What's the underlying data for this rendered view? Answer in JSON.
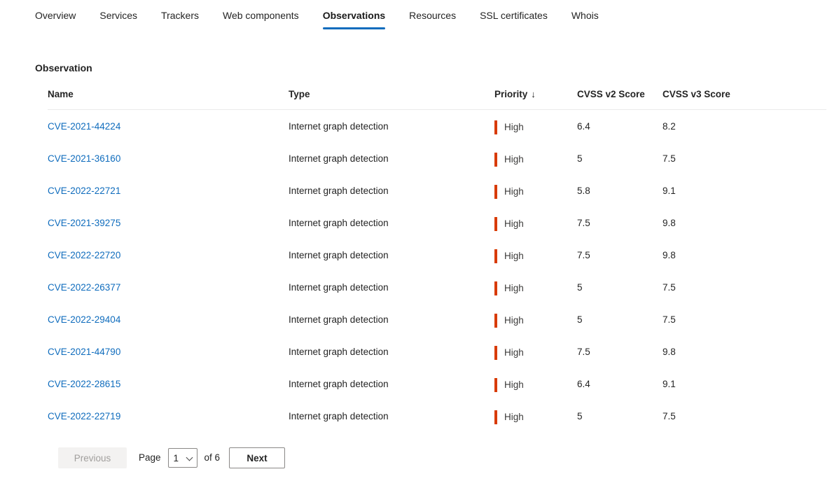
{
  "tabs": [
    {
      "label": "Overview",
      "active": false
    },
    {
      "label": "Services",
      "active": false
    },
    {
      "label": "Trackers",
      "active": false
    },
    {
      "label": "Web components",
      "active": false
    },
    {
      "label": "Observations",
      "active": true
    },
    {
      "label": "Resources",
      "active": false
    },
    {
      "label": "SSL certificates",
      "active": false
    },
    {
      "label": "Whois",
      "active": false
    }
  ],
  "section": {
    "heading": "Observation"
  },
  "table": {
    "columns": [
      {
        "key": "name",
        "label": "Name",
        "sorted": false
      },
      {
        "key": "type",
        "label": "Type",
        "sorted": false
      },
      {
        "key": "prio",
        "label": "Priority",
        "sorted": true,
        "sort_icon": "↓"
      },
      {
        "key": "cvss2",
        "label": "CVSS v2 Score",
        "sorted": false
      },
      {
        "key": "cvss3",
        "label": "CVSS v3 Score",
        "sorted": false
      }
    ],
    "rows": [
      {
        "name": "CVE-2021-44224",
        "type": "Internet graph detection",
        "priority": "High",
        "cvss_v2": "6.4",
        "cvss_v3": "8.2"
      },
      {
        "name": "CVE-2021-36160",
        "type": "Internet graph detection",
        "priority": "High",
        "cvss_v2": "5",
        "cvss_v3": "7.5"
      },
      {
        "name": "CVE-2022-22721",
        "type": "Internet graph detection",
        "priority": "High",
        "cvss_v2": "5.8",
        "cvss_v3": "9.1"
      },
      {
        "name": "CVE-2021-39275",
        "type": "Internet graph detection",
        "priority": "High",
        "cvss_v2": "7.5",
        "cvss_v3": "9.8"
      },
      {
        "name": "CVE-2022-22720",
        "type": "Internet graph detection",
        "priority": "High",
        "cvss_v2": "7.5",
        "cvss_v3": "9.8"
      },
      {
        "name": "CVE-2022-26377",
        "type": "Internet graph detection",
        "priority": "High",
        "cvss_v2": "5",
        "cvss_v3": "7.5"
      },
      {
        "name": "CVE-2022-29404",
        "type": "Internet graph detection",
        "priority": "High",
        "cvss_v2": "5",
        "cvss_v3": "7.5"
      },
      {
        "name": "CVE-2021-44790",
        "type": "Internet graph detection",
        "priority": "High",
        "cvss_v2": "7.5",
        "cvss_v3": "9.8"
      },
      {
        "name": "CVE-2022-28615",
        "type": "Internet graph detection",
        "priority": "High",
        "cvss_v2": "6.4",
        "cvss_v3": "9.1"
      },
      {
        "name": "CVE-2022-22719",
        "type": "Internet graph detection",
        "priority": "High",
        "cvss_v2": "5",
        "cvss_v3": "7.5"
      }
    ]
  },
  "pagination": {
    "previous_label": "Previous",
    "previous_disabled": true,
    "page_label": "Page",
    "current_page": "1",
    "of_label": "of 6",
    "total_pages": 6,
    "next_label": "Next",
    "page_options": [
      "1",
      "2",
      "3",
      "4",
      "5",
      "6"
    ]
  },
  "colors": {
    "accent": "#0f6cbd",
    "link": "#0f6cbd",
    "priority_high": "#d83b01",
    "text": "#242424",
    "disabled_text": "#a19f9d",
    "border": "#8a8886",
    "rule": "#ebebeb"
  }
}
